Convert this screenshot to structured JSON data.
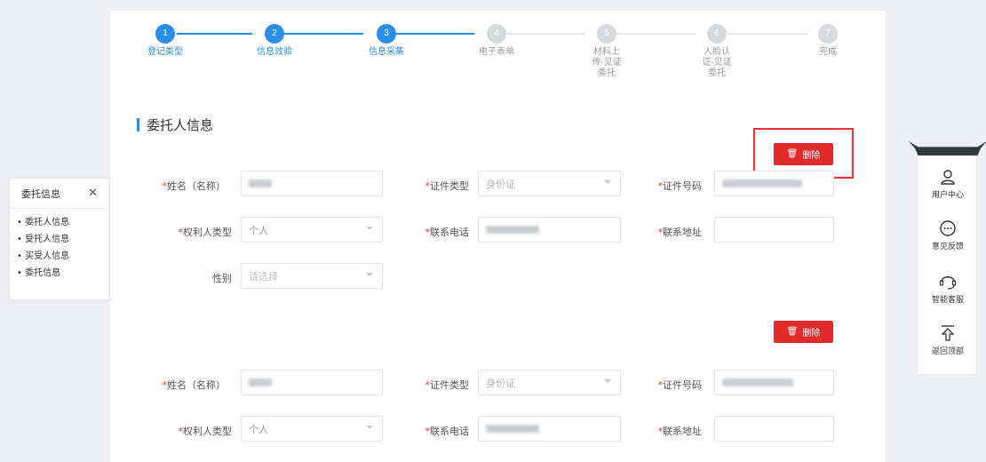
{
  "steps": [
    {
      "num": "1",
      "label": "登记类型",
      "state": "active"
    },
    {
      "num": "2",
      "label": "信息效验",
      "state": "active"
    },
    {
      "num": "3",
      "label": "信息采集",
      "state": "active"
    },
    {
      "num": "4",
      "label": "电子表单",
      "state": "inactive"
    },
    {
      "num": "5",
      "label": "材料上传-见证委托",
      "state": "inactive"
    },
    {
      "num": "6",
      "label": "人脸认证-见证委托",
      "state": "inactive"
    },
    {
      "num": "7",
      "label": "完成",
      "state": "inactive"
    }
  ],
  "section": {
    "title": "委托人信息"
  },
  "delete_label": "删除",
  "form": {
    "name_label": "姓名（名称）",
    "id_type_label": "证件类型",
    "id_type_value": "身份证",
    "id_no_label": "证件号码",
    "holder_type_label": "权利人类型",
    "holder_type_value": "个人",
    "phone_label": "联系电话",
    "address_label": "联系地址",
    "gender_label": "性别",
    "gender_placeholder": "请选择"
  },
  "left_panel": {
    "title": "委托信息",
    "items": [
      "委托人信息",
      "受托人信息",
      "买受人信息",
      "委托信息"
    ]
  },
  "right_panel": {
    "items": [
      {
        "icon": "user-icon",
        "label": "用户中心"
      },
      {
        "icon": "chat-icon",
        "label": "意见反馈"
      },
      {
        "icon": "headset-icon",
        "label": "智能客服"
      },
      {
        "icon": "arrow-up-icon",
        "label": "返回顶部"
      }
    ]
  },
  "colors": {
    "accent": "#2a8de6",
    "danger": "#e22b2b"
  }
}
